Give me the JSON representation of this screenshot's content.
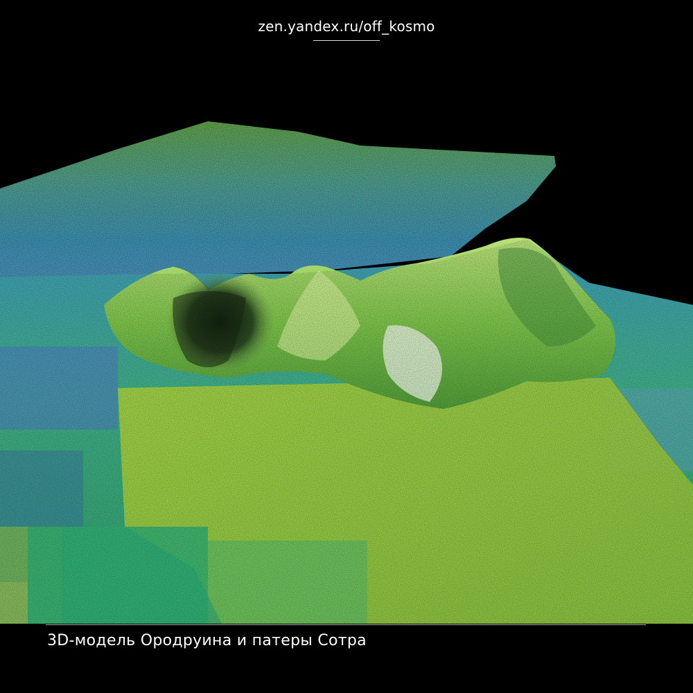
{
  "watermark": "zen.yandex.ru/off_kosmo",
  "caption": "3D-модель Ородруина и патеры Сотра",
  "image": {
    "subject": "3D terrain model: two mountain peaks beside a deep crater on a textured green-blue-yellow surface",
    "palette": {
      "background": "#000000",
      "green": "#6fbf3a",
      "yellow": "#c7d93a",
      "blue": "#3a8fc4",
      "teal": "#3fb59a"
    }
  }
}
